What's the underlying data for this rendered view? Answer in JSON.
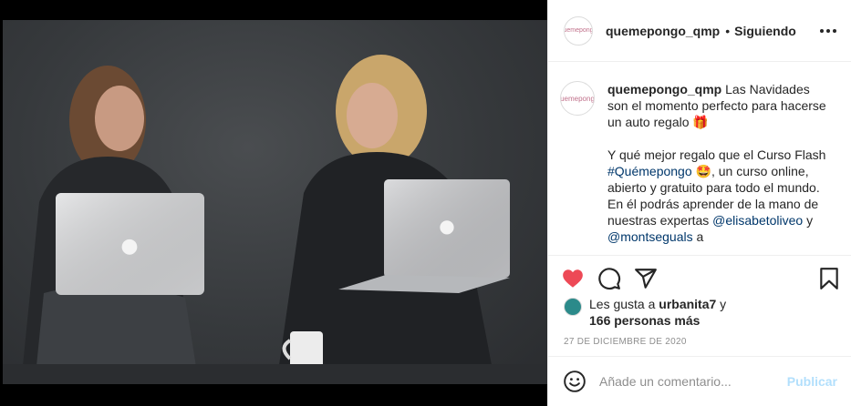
{
  "post": {
    "photo_alt": "Two women sitting with laptops",
    "header": {
      "avatar_text": "quemepongo",
      "username": "quemepongo_qmp",
      "separator": "•",
      "follow_status": "Siguiendo",
      "more_icon": "more-horizontal-icon"
    },
    "caption": {
      "avatar_text": "quemepongo",
      "username": "quemepongo_qmp",
      "line1": " Las Navidades son el momento perfecto para hacerse un auto regalo 🎁",
      "line2_a": "Y qué mejor regalo que el Curso Flash ",
      "hashtag": "#Quémepongo",
      "line2_b": " 🤩, un curso online, abierto y gratuito para todo el mundo. En él podrás aprender de la mano de nuestras expertas ",
      "mention1": "@elisabetoliveo",
      "and": " y ",
      "mention2": "@montseguals",
      "line2_c": " a"
    },
    "actions": {
      "like_icon": "heart-filled-icon",
      "comment_icon": "comment-icon",
      "share_icon": "share-icon",
      "save_icon": "bookmark-icon",
      "like_color": "#ed4956"
    },
    "likes": {
      "prefix": "Les gusta a ",
      "first_user": "urbanita7",
      "connector": " y",
      "others": "166 personas más"
    },
    "date": "27 DE DICIEMBRE DE 2020",
    "comment": {
      "placeholder": "Añade un comentario...",
      "post_label": "Publicar",
      "emoji_icon": "smiley-icon"
    }
  }
}
